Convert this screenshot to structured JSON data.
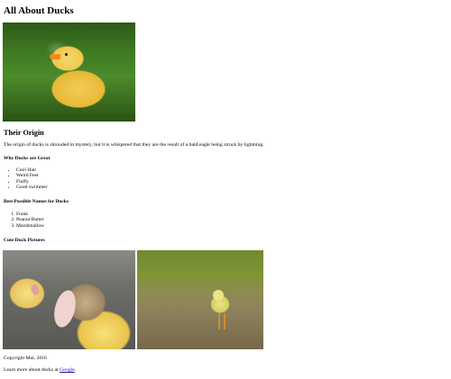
{
  "page": {
    "title": "All About Ducks"
  },
  "origin": {
    "heading": "Their Origin",
    "text": "The origin of ducks is shrouded in mystery, but it is whispered that they are the result of a bald eagle being struck by lightning."
  },
  "why_great": {
    "heading": "Why Ducks are Great",
    "items": [
      "Cool Hair",
      "Weird Feet",
      "Fluffy",
      "Good swimmer"
    ]
  },
  "names": {
    "heading": "Best Possible Names for Ducks",
    "items": [
      "Frank",
      "Peanut Butter",
      "Marshmallow"
    ]
  },
  "pictures": {
    "heading": "Cute Duck Pictures"
  },
  "footer": {
    "copyright": "Copyright Mai, 2016",
    "learn_prefix": "Learn more about ducks at ",
    "link_text": "Google",
    "learn_suffix": "."
  }
}
